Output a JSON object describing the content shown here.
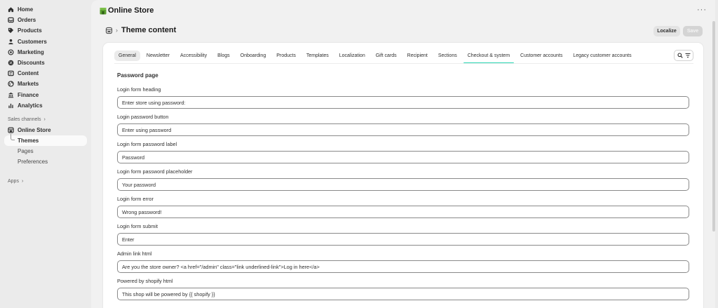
{
  "sidebar": {
    "items": [
      {
        "label": "Home",
        "icon": "home-icon"
      },
      {
        "label": "Orders",
        "icon": "inbox-icon"
      },
      {
        "label": "Products",
        "icon": "tag-icon"
      },
      {
        "label": "Customers",
        "icon": "person-icon"
      },
      {
        "label": "Marketing",
        "icon": "target-icon"
      },
      {
        "label": "Discounts",
        "icon": "discount-icon"
      },
      {
        "label": "Content",
        "icon": "content-icon"
      },
      {
        "label": "Markets",
        "icon": "globe-icon"
      },
      {
        "label": "Finance",
        "icon": "bank-icon"
      },
      {
        "label": "Analytics",
        "icon": "chart-icon"
      }
    ],
    "sales_channels_label": "Sales channels",
    "online_store_label": "Online Store",
    "sub_items": [
      "Themes",
      "Pages",
      "Preferences"
    ],
    "apps_label": "Apps"
  },
  "header": {
    "store_title": "Online Store",
    "page_title": "Theme content",
    "localize_label": "Localize",
    "save_label": "Save"
  },
  "tabs": [
    "General",
    "Newsletter",
    "Accessibility",
    "Blogs",
    "Onboarding",
    "Products",
    "Templates",
    "Localization",
    "Gift cards",
    "Recipient",
    "Sections",
    "Checkout & system",
    "Customer accounts",
    "Legacy customer accounts"
  ],
  "active_tab": "General",
  "underlined_tab": "Checkout & system",
  "section": {
    "title": "Password page",
    "fields": [
      {
        "label": "Login form heading",
        "value": "Enter store using password:"
      },
      {
        "label": "Login password button",
        "value": "Enter using password"
      },
      {
        "label": "Login form password label",
        "value": "Password"
      },
      {
        "label": "Login form password placeholder",
        "value": "Your password"
      },
      {
        "label": "Login form error",
        "value": "Wrong password!"
      },
      {
        "label": "Login form submit",
        "value": "Enter"
      },
      {
        "label": "Admin link html",
        "value": "Are you the store owner? <a href=\"/admin\" class=\"link underlined-link\">Log in here</a>"
      },
      {
        "label": "Powered by shopify html",
        "value": "This shop will be powered by {{ shopify }}"
      }
    ]
  },
  "colors": {
    "accent_underline": "#29d6b4",
    "store_logo": "#5a9e2f"
  }
}
